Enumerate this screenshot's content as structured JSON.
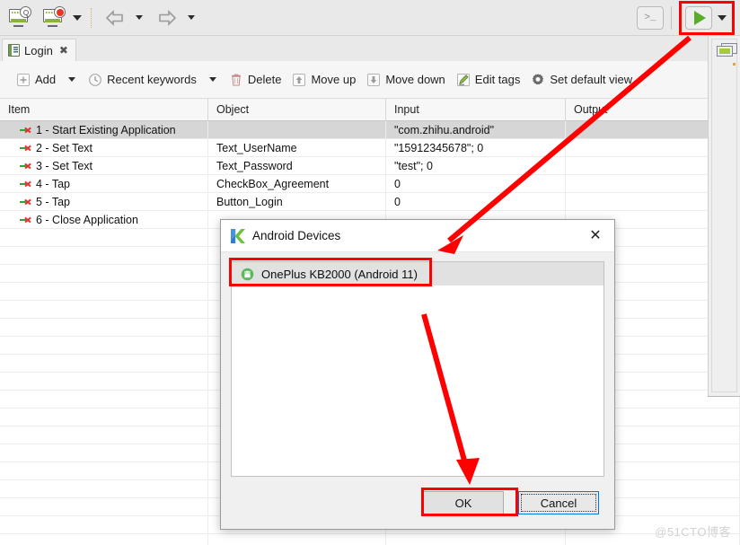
{
  "toolbar_top": {
    "buttons": [
      {
        "name": "spy-object-icon",
        "title": "Spy Object"
      },
      {
        "name": "record-icon",
        "title": "Record"
      }
    ],
    "dropdown_caret": "▼",
    "back_label": "Back",
    "forward_label": "Forward",
    "console_glyph": ">_",
    "run_label": "Run",
    "run_caret": "▼"
  },
  "tab": {
    "label": "Login",
    "close_glyph": "✖"
  },
  "actions": [
    {
      "label": "Add",
      "icon": "plus-box-icon",
      "has_caret": true
    },
    {
      "label": "Recent keywords",
      "icon": "clock-icon",
      "has_caret": true
    },
    {
      "label": "Delete",
      "icon": "trash-icon",
      "has_caret": false
    },
    {
      "label": "Move up",
      "icon": "arrow-up-box-icon",
      "has_caret": false
    },
    {
      "label": "Move down",
      "icon": "arrow-down-box-icon",
      "has_caret": false
    },
    {
      "label": "Edit tags",
      "icon": "pencil-edit-icon",
      "has_caret": false
    },
    {
      "label": "Set default view",
      "icon": "gear-icon",
      "has_caret": false
    }
  ],
  "table": {
    "columns": [
      "Item",
      "Object",
      "Input",
      "Output"
    ],
    "rows": [
      {
        "item": "1 - Start Existing Application",
        "object": "",
        "input": "\"com.zhihu.android\"",
        "output": "",
        "selected": true
      },
      {
        "item": "2 - Set Text",
        "object": "Text_UserName",
        "input": "\"15912345678\"; 0",
        "output": "",
        "selected": false
      },
      {
        "item": "3 - Set Text",
        "object": "Text_Password",
        "input": "\"test\"; 0",
        "output": "",
        "selected": false
      },
      {
        "item": "4 - Tap",
        "object": "CheckBox_Agreement",
        "input": "0",
        "output": "",
        "selected": false
      },
      {
        "item": "5 - Tap",
        "object": "Button_Login",
        "input": "0",
        "output": "",
        "selected": false
      },
      {
        "item": "6 - Close Application",
        "object": "",
        "input": "",
        "output": "",
        "selected": false
      }
    ],
    "empty_row_count": 18
  },
  "dialog": {
    "title": "Android Devices",
    "close_glyph": "✕",
    "devices": [
      {
        "label": "OnePlus KB2000 (Android 11)",
        "selected": true
      }
    ],
    "ok_label": "OK",
    "cancel_label": "Cancel"
  },
  "annotations": {
    "highlight_color": "#ff0000",
    "arrows": [
      {
        "name": "arrow-run-to-dialog"
      },
      {
        "name": "arrow-device-to-ok"
      }
    ]
  },
  "watermark": "@51CTO博客",
  "colors": {
    "accent_red": "#ff0000",
    "play_green": "#5aac2b",
    "selection_gray": "#d6d6d6",
    "focus_blue": "#0078d7"
  }
}
